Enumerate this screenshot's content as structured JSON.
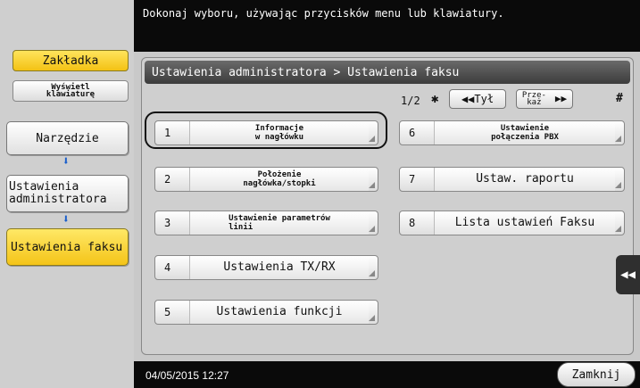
{
  "left": {
    "tab_label": "Zakładka",
    "keyboard_btn": [
      "Wyświetl",
      "klawiaturę"
    ],
    "narzedzie": "Narzędzie",
    "admin": [
      "Ustawienia",
      "administratora"
    ],
    "faks": "Ustawienia faksu"
  },
  "topbar": {
    "message": "Dokonaj wyboru, używając przycisków menu lub klawiatury."
  },
  "main": {
    "breadcrumb": "Ustawienia administratora  > Ustawienia faksu",
    "page_indicator": "1/2",
    "star": "✱",
    "back_label": "◀◀Tył",
    "next_label": [
      "Prze-",
      "każ"
    ],
    "next_arrow": "▶▶",
    "hash": "#",
    "items": [
      {
        "num": "1",
        "label": [
          "Informacje",
          "w nagłówku"
        ]
      },
      {
        "num": "2",
        "label": [
          "Położenie",
          "nagłówka/stopki"
        ]
      },
      {
        "num": "3",
        "label": [
          "Ustawienie parametrów",
          "linii"
        ]
      },
      {
        "num": "4",
        "label": "Ustawienia TX/RX"
      },
      {
        "num": "5",
        "label": "Ustawienia funkcji"
      },
      {
        "num": "6",
        "label": [
          "Ustawienie",
          "połączenia PBX"
        ]
      },
      {
        "num": "7",
        "label": "Ustaw. raportu"
      },
      {
        "num": "8",
        "label": "Lista ustawień Faksu"
      }
    ]
  },
  "bottom": {
    "datetime": "04/05/2015  12:27",
    "close_label": "Zamknij"
  },
  "side_tab": "◀◀",
  "arrow": "⬇"
}
